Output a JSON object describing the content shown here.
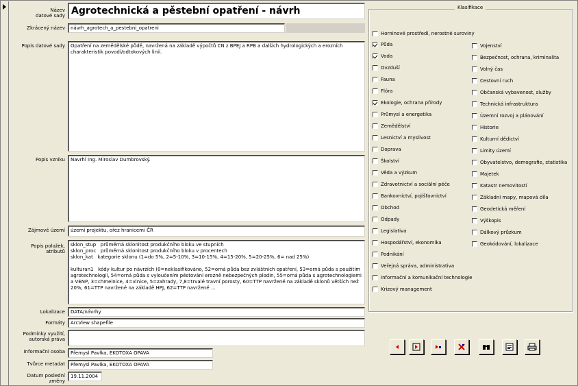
{
  "record_selector": {
    "icon": "record-pointer-icon"
  },
  "labels": {
    "nazev": "Název\ndatové sady",
    "zkraceny": "Zkrácený název",
    "popis": "Popis datové sady",
    "vznik": "Popis vzniku",
    "zajmove": "Zájmové území",
    "polozky": "Popis položek,\natributů",
    "lokalizace": "Lokalizace",
    "formaty": "Formáty",
    "podminky": "Podmínky využití,\nautorská práva",
    "osoba": "Informační osoba",
    "tvurce": "Tvůrce metadat",
    "datum": "Datum poslední\nzměny"
  },
  "fields": {
    "nazev": "Agrotechnická a pěstební opatření - návrh",
    "zkraceny": "návrh_agrotech_a_pestebni_opatreni",
    "popis": "Opatření na zemědělské půdě, navržená na základě výpočtů CN z BPEJ a RPB a dalších hydrologických a erozních charakteristik povodí/odtokových linií.",
    "vznik": "Navrhl Ing. Miroslav Dumbrovský.",
    "zajmove": "území projektu, ořez hranicemi ČR",
    "polozky": "sklon_stup   průměrná sklonitost produkčního bloku ve stupních\nsklon_proc   průměrná sklonitost produkčního bloku v procentech\nsklon_kat   kategorie sklonu (1=do 5%, 2=5-10%, 3=10-15%, 4=15-20%, 5=20-25%, 6= nad 25%)\n\nkulturan1   kódy kultur po návrzích (0=neklasifikováno, 52=orná půda bez zvláštních opatření, 53=orná půda s použitím agrotechnologií, 54=orná půda s vyloučením pěstování erozně nebezpečných plodin, 55=orná půda s agrotechnologiemi a VENP, 3=chmelnice, 4=vinice, 5=zahrady, 7,8=trvalé travní porosty, 60=TTP navržené na základě sklonů větších než 20%, 61=TTP navržené na základě HPJ, 62=TTP navržené ...",
    "lokalizace": "DATA/návrhy",
    "formaty": "ArcView shapefile",
    "podminky": "",
    "osoba": "Přemysl Pavlka, EKOTOXA OPAVA",
    "tvurce": "Přemysl Pavlka, EKOTOXA OPAVA",
    "datum": "19.11.2004"
  },
  "klasifikace": {
    "legend": "Klasifikace",
    "top": {
      "label": "Horninové prostředí, nerostné suroviny",
      "checked": false
    },
    "left": [
      {
        "label": "Půda",
        "checked": true
      },
      {
        "label": "Voda",
        "checked": true
      },
      {
        "label": "Ovzduší",
        "checked": false
      },
      {
        "label": "Fauna",
        "checked": false
      },
      {
        "label": "Flóra",
        "checked": false
      },
      {
        "label": "Ekologie, ochrana přírody",
        "checked": true
      },
      {
        "label": "Průmysl a energetika",
        "checked": false
      },
      {
        "label": "Zemědělství",
        "checked": false
      },
      {
        "label": "Lesnictví a myslivost",
        "checked": false
      },
      {
        "label": "Doprava",
        "checked": false
      },
      {
        "label": "Školství",
        "checked": false
      },
      {
        "label": "Věda a výzkum",
        "checked": false
      },
      {
        "label": "Zdravotnictví a sociální péče",
        "checked": false
      },
      {
        "label": "Bankovnictví, pojišťovnictví",
        "checked": false
      },
      {
        "label": "Obchod",
        "checked": false
      },
      {
        "label": "Odpady",
        "checked": false
      },
      {
        "label": "Legislativa",
        "checked": false
      },
      {
        "label": "Hospodářství, ekonomika",
        "checked": false
      },
      {
        "label": "Podnikání",
        "checked": false
      },
      {
        "label": "Veřejná správa, administrativa",
        "checked": false
      },
      {
        "label": "Informační a komunikační technologie",
        "checked": false
      },
      {
        "label": "Krizový management",
        "checked": false
      }
    ],
    "right": [
      {
        "label": "Vojenství",
        "checked": false
      },
      {
        "label": "Bezpečnost, ochrana, kriminalita",
        "checked": false
      },
      {
        "label": "Volný čas",
        "checked": false
      },
      {
        "label": "Cestovní ruch",
        "checked": false
      },
      {
        "label": "Občanská vybavenost, služby",
        "checked": false
      },
      {
        "label": "Technická infrastruktura",
        "checked": false
      },
      {
        "label": "Územní rozvoj a plánování",
        "checked": false
      },
      {
        "label": "Historie",
        "checked": false
      },
      {
        "label": "Kulturní dědictví",
        "checked": false
      },
      {
        "label": "Limity území",
        "checked": false
      },
      {
        "label": "Obyvatelstvo, demografie, statistika",
        "checked": false
      },
      {
        "label": "Majetek",
        "checked": false
      },
      {
        "label": "Katastr nemovitostí",
        "checked": false
      },
      {
        "label": "Základní mapy, mapová díla",
        "checked": false
      },
      {
        "label": "Geodetická měření",
        "checked": false
      },
      {
        "label": "Výškopis",
        "checked": false
      },
      {
        "label": "Dálkový průzkum",
        "checked": false
      },
      {
        "label": "Geokódování, lokalizace",
        "checked": false
      }
    ]
  },
  "toolbar": {
    "buttons": [
      {
        "name": "previous-record-button",
        "icon": "arrow-left-icon"
      },
      {
        "name": "next-record-button",
        "icon": "arrow-right-icon"
      },
      {
        "name": "new-record-button",
        "icon": "new-record-icon"
      },
      {
        "name": "delete-record-button",
        "icon": "delete-record-icon"
      },
      {
        "name": "find-button",
        "icon": "binoculars-icon"
      },
      {
        "name": "report-button",
        "icon": "report-icon"
      },
      {
        "name": "print-button",
        "icon": "printer-icon"
      }
    ],
    "colors": {
      "accent": "#cc0000",
      "button_face": "#ece9d8"
    }
  }
}
